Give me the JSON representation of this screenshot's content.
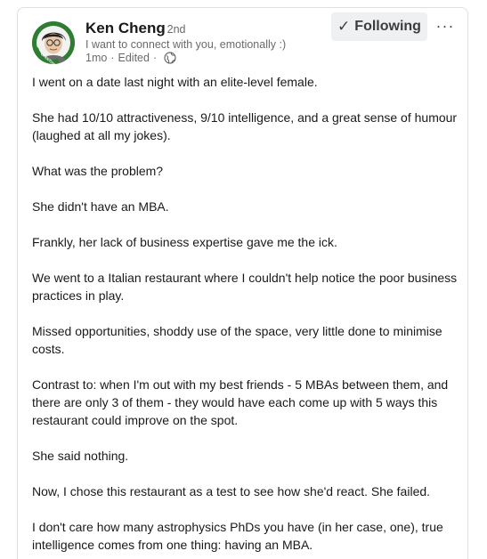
{
  "author": {
    "name": "Ken Cheng",
    "degree": "· 2nd",
    "headline": "I want to connect with you, emotionally :)",
    "time": "1mo",
    "edited": "Edited",
    "visibility_icon": "globe-icon",
    "avatar_badge": "OPENTOWORK"
  },
  "actions": {
    "follow_label": "Following",
    "follow_icon": "✓",
    "more_label": "···"
  },
  "post": {
    "paragraphs": [
      "I went on a date last night with an elite-level female.",
      "She had 10/10 attractiveness, 9/10 intelligence, and a great sense of humour (laughed at all my jokes).",
      "What was the problem?",
      "She didn't have an MBA.",
      "Frankly, her lack of business expertise gave me the ick.",
      "We went to a Italian restaurant where I couldn't help notice the poor business practices in play.",
      "Missed opportunities, shoddy use of the space, very little done to minimise costs.",
      "Contrast to: when I'm out with my best friends - 5 MBAs between them, and there are only 3 of them - they would have each come up with 5 ways this restaurant could improve on the spot.",
      "She said nothing.",
      "Now, I chose this restaurant as a test to see how she'd react. She failed.",
      "I don't care how many astrophysics PhDs you have (in her case, one), true intelligence comes from one thing: having an MBA."
    ]
  },
  "colors": {
    "open_to_work_green": "#2e7d32",
    "border": "#e0dfdc",
    "button_bg": "#eef0f2"
  }
}
